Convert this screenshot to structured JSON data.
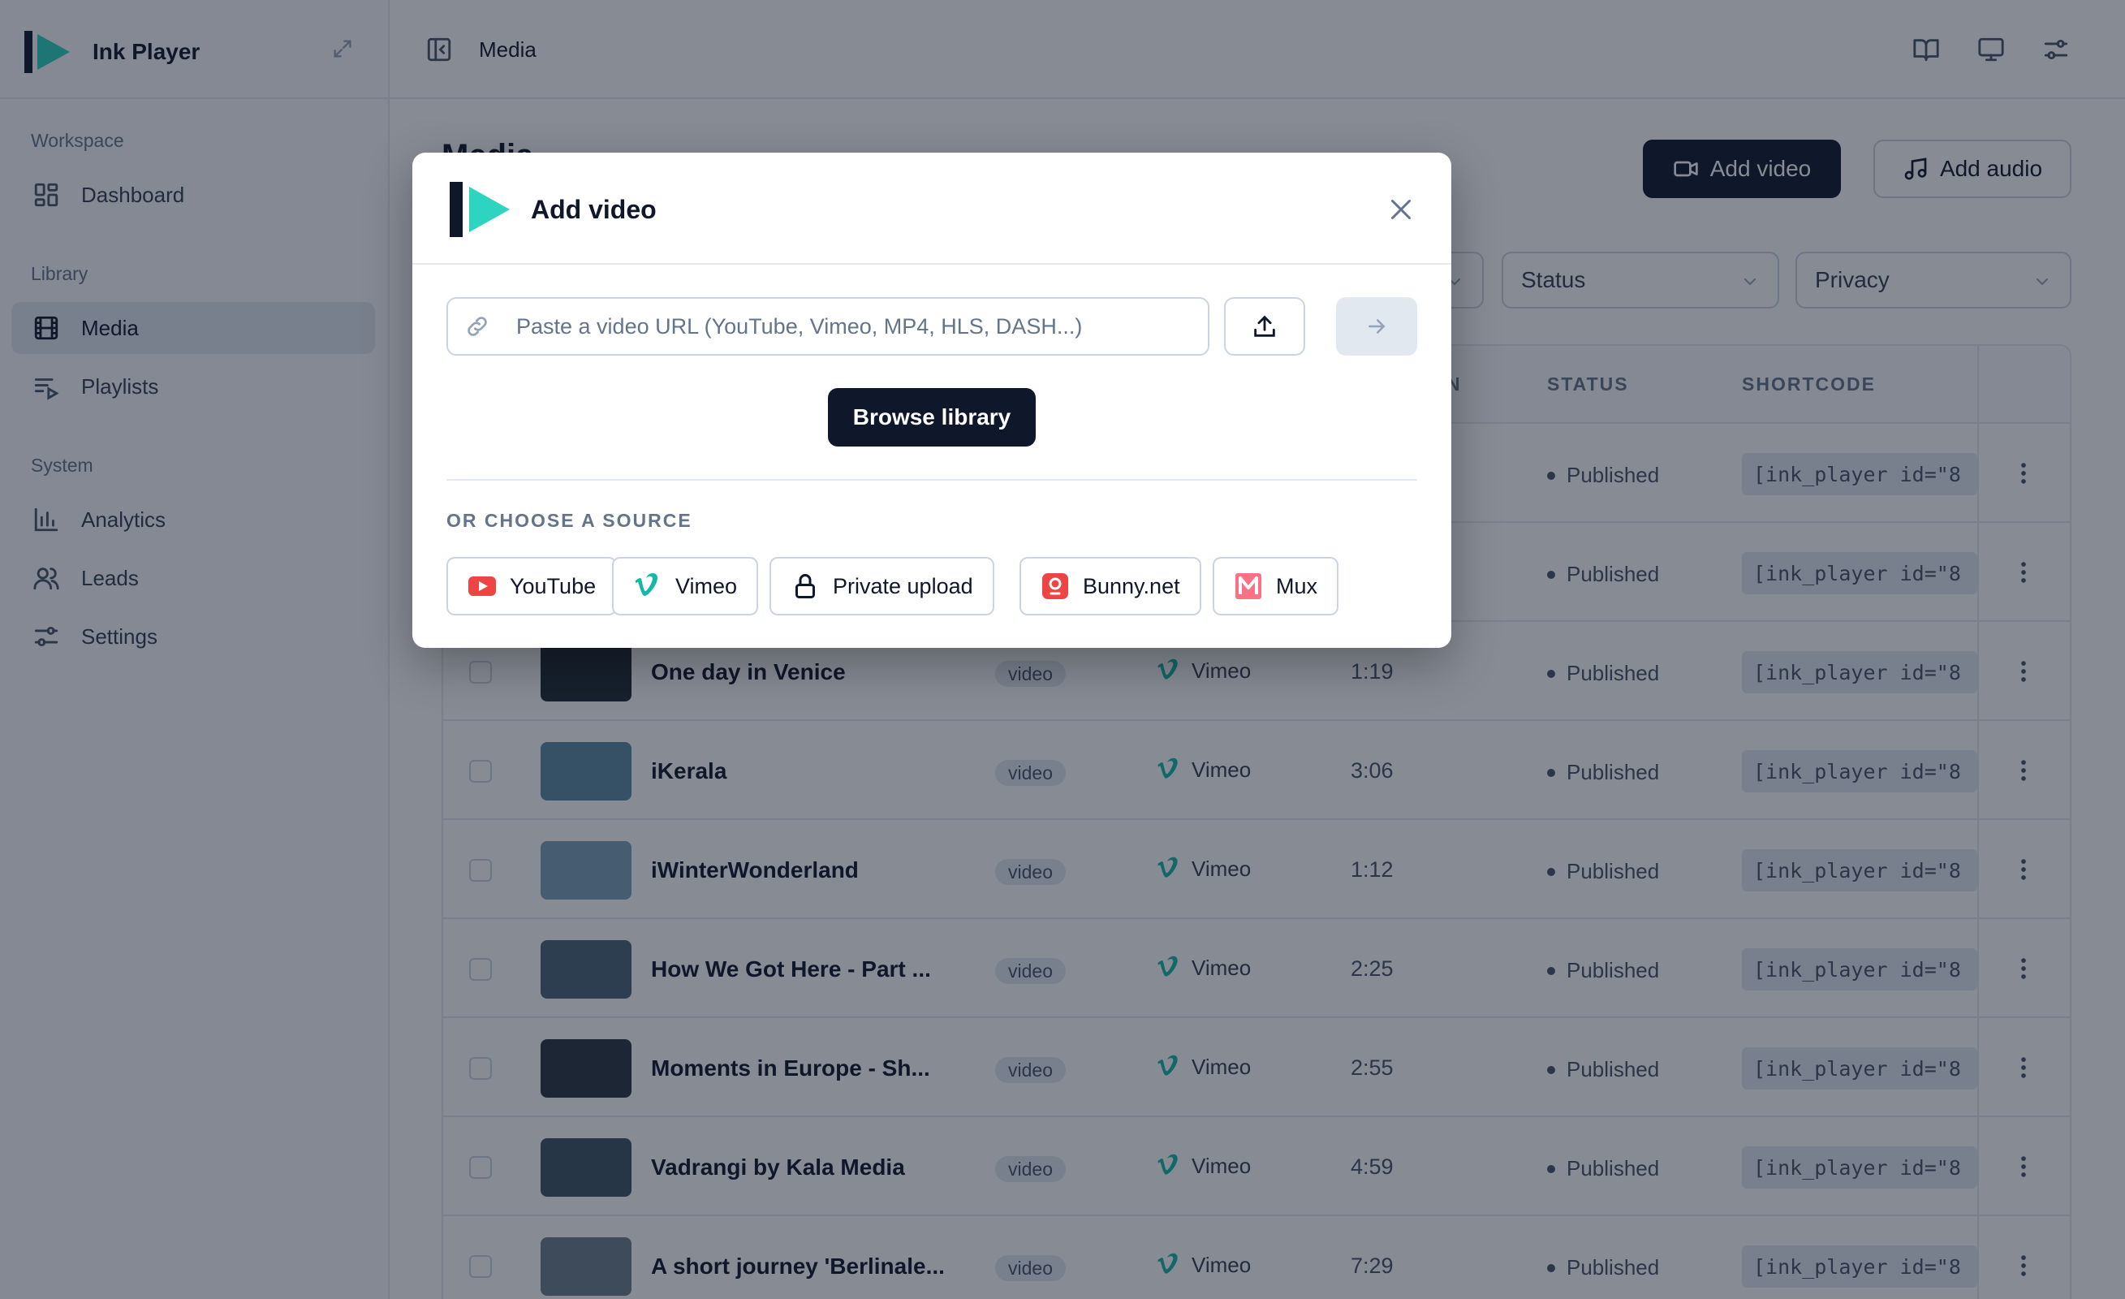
{
  "app": {
    "name": "Ink Player"
  },
  "sidebar": {
    "sections": [
      {
        "label": "Workspace",
        "items": [
          {
            "label": "Dashboard",
            "icon": "dashboard-icon"
          }
        ]
      },
      {
        "label": "Library",
        "items": [
          {
            "label": "Media",
            "icon": "film-icon",
            "active": true
          },
          {
            "label": "Playlists",
            "icon": "playlist-icon"
          }
        ]
      },
      {
        "label": "System",
        "items": [
          {
            "label": "Analytics",
            "icon": "chart-icon"
          },
          {
            "label": "Leads",
            "icon": "users-icon"
          },
          {
            "label": "Settings",
            "icon": "sliders-icon"
          }
        ]
      }
    ]
  },
  "header": {
    "breadcrumb": "Media"
  },
  "main": {
    "title": "Media",
    "add_video_label": "Add video",
    "add_audio_label": "Add audio",
    "filters": {
      "status": "Status",
      "privacy": "Privacy"
    },
    "columns": {
      "status": "STATUS",
      "shortcode": "SHORTCODE",
      "partial": "N"
    },
    "rows": [
      {
        "title": "",
        "type": "",
        "provider": "",
        "duration": "",
        "status": "Published",
        "shortcode": "[ink_player id=\"8",
        "thumb": "#3b4a55"
      },
      {
        "title": "",
        "type": "",
        "provider": "",
        "duration": "",
        "status": "Published",
        "shortcode": "[ink_player id=\"8",
        "thumb": "#52606b"
      },
      {
        "title": "One day in Venice",
        "type": "video",
        "provider": "Vimeo",
        "duration": "1:19",
        "status": "Published",
        "shortcode": "[ink_player id=\"8",
        "thumb": "#1e2833"
      },
      {
        "title": "iKerala",
        "type": "video",
        "provider": "Vimeo",
        "duration": "3:06",
        "status": "Published",
        "shortcode": "[ink_player id=\"8",
        "thumb": "#5d8aa0"
      },
      {
        "title": "iWinterWonderland",
        "type": "video",
        "provider": "Vimeo",
        "duration": "1:12",
        "status": "Published",
        "shortcode": "[ink_player id=\"8",
        "thumb": "#7aa0b8"
      },
      {
        "title": "How We Got Here - Part ...",
        "type": "video",
        "provider": "Vimeo",
        "duration": "2:25",
        "status": "Published",
        "shortcode": "[ink_player id=\"8",
        "thumb": "#4d6578"
      },
      {
        "title": "Moments in Europe - Sh...",
        "type": "video",
        "provider": "Vimeo",
        "duration": "2:55",
        "status": "Published",
        "shortcode": "[ink_player id=\"8",
        "thumb": "#2b3540"
      },
      {
        "title": "Vadrangi by Kala Media",
        "type": "video",
        "provider": "Vimeo",
        "duration": "4:59",
        "status": "Published",
        "shortcode": "[ink_player id=\"8",
        "thumb": "#3c5565"
      },
      {
        "title": "A short journey 'Berlinale...",
        "type": "video",
        "provider": "Vimeo",
        "duration": "7:29",
        "status": "Published",
        "shortcode": "[ink_player id=\"8",
        "thumb": "#6a7f8d"
      }
    ]
  },
  "modal": {
    "title": "Add video",
    "url_placeholder": "Paste a video URL (YouTube, Vimeo, MP4, HLS, DASH...)",
    "browse_label": "Browse library",
    "sources_label": "OR CHOOSE A SOURCE",
    "sources": [
      {
        "label": "YouTube",
        "icon": "youtube-icon"
      },
      {
        "label": "Vimeo",
        "icon": "vimeo-icon"
      },
      {
        "label": "Private upload",
        "icon": "lock-icon"
      },
      {
        "label": "Bunny.net",
        "icon": "bunny-icon"
      },
      {
        "label": "Mux",
        "icon": "mux-icon"
      }
    ]
  },
  "colors": {
    "brand_dark": "#0f172a",
    "brand_accent": "#2dd4bf",
    "youtube": "#ef4444",
    "vimeo": "#14b8a6",
    "bunny": "#ef4444",
    "mux": "#f43f5e"
  }
}
